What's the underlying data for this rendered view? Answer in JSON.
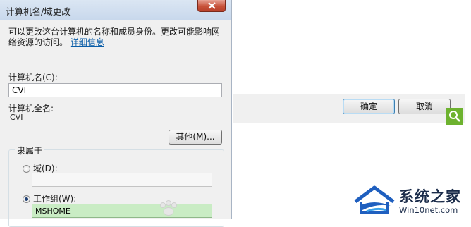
{
  "dialog": {
    "title": "计算机名/域更改",
    "description": "可以更改这台计算机的名称和成员身份。更改可能影响网络资源的访问。",
    "details_link": "详细信息",
    "computer_name_label": "计算机名(C):",
    "computer_name_value": "CVI",
    "full_name_label": "计算机全名:",
    "full_name_value": "CVI",
    "other_button": "其他(M)...",
    "member_of_title": "隶属于",
    "domain_radio_label": "域(D):",
    "domain_value": "",
    "workgroup_radio_label": "工作组(W):",
    "workgroup_value": "MSHOME",
    "selected": "workgroup"
  },
  "second_dialog": {
    "ok_label": "确定",
    "cancel_label": "取消"
  },
  "watermark": {
    "brand": "系统之家",
    "site": "Win10net.com"
  },
  "colors": {
    "titlebar": "#c8d8ec",
    "close_button": "#c7523a",
    "link": "#0b5ea8",
    "search_accent": "#6db22f",
    "workgroup_highlight": "#c9ecc4"
  }
}
